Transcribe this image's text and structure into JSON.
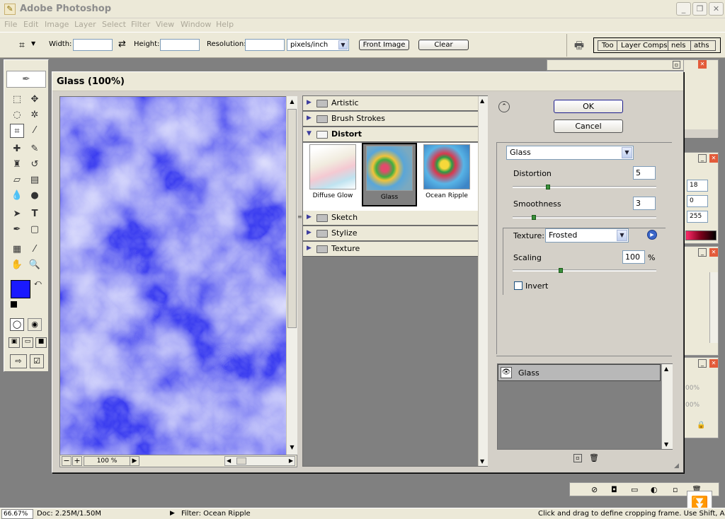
{
  "app": {
    "title": "Adobe Photoshop"
  },
  "menu": [
    "File",
    "Edit",
    "Image",
    "Layer",
    "Select",
    "Filter",
    "View",
    "Window",
    "Help"
  ],
  "options": {
    "width_label": "Width:",
    "height_label": "Height:",
    "resolution_label": "Resolution:",
    "units": "pixels/inch",
    "front_image": "Front Image",
    "clear": "Clear",
    "tabs": [
      "Too",
      "Layer Comps",
      "nels",
      "aths"
    ]
  },
  "dialog": {
    "title": "Glass (100%)",
    "zoom": "100 %",
    "ok": "OK",
    "cancel": "Cancel",
    "categories": [
      {
        "name": "Artistic",
        "expanded": false
      },
      {
        "name": "Brush Strokes",
        "expanded": false
      },
      {
        "name": "Distort",
        "expanded": true
      },
      {
        "name": "Sketch",
        "expanded": false
      },
      {
        "name": "Stylize",
        "expanded": false
      },
      {
        "name": "Texture",
        "expanded": false
      }
    ],
    "thumbnails": [
      "Diffuse Glow",
      "Glass",
      "Ocean Ripple"
    ],
    "selected_filter": "Glass",
    "filter_dropdown": "Glass",
    "distortion_label": "Distortion",
    "distortion": "5",
    "smoothness_label": "Smoothness",
    "smoothness": "3",
    "texture_label": "Texture:",
    "texture": "Frosted",
    "scaling_label": "Scaling",
    "scaling": "100",
    "percent": "%",
    "invert_label": "Invert",
    "invert_checked": false,
    "layer_name": "Glass"
  },
  "panels": {
    "color_values": [
      "18",
      "0",
      "255"
    ],
    "opacity_a": "00%",
    "opacity_b": "00%"
  },
  "status": {
    "zoom": "66.67%",
    "doc": "Doc: 2.25M/1.50M",
    "filter": "Filter: Ocean Ripple",
    "hint": "Click and drag to define cropping frame.  Use Shift, Alt, and"
  },
  "colors": {
    "foreground": "#1a1aff",
    "background": "#ffffff",
    "preview_tint": "#4a4cf0"
  }
}
